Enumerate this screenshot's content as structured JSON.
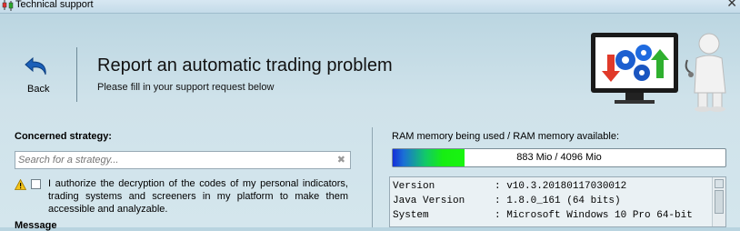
{
  "window": {
    "title": "Technical support"
  },
  "header": {
    "back_label": "Back",
    "title": "Report an automatic trading problem",
    "subtitle": "Please fill in your support request below"
  },
  "form": {
    "strategy_label": "Concerned strategy:",
    "search_placeholder": "Search for a strategy...",
    "consent_text": "I authorize the decryption of the codes of my personal indicators, trading systems and screeners in my platform to make them accessible and analyzable.",
    "consent_checked": false,
    "message_label": "Message"
  },
  "system": {
    "ram_label": "RAM memory being used / RAM memory available:",
    "ram_used_mio": 883,
    "ram_total_mio": 4096,
    "ram_text": "883 Mio / 4096 Mio",
    "info_rows": [
      {
        "key": "Version",
        "value": ": v10.3.20180117030012"
      },
      {
        "key": "Java Version",
        "value": ": 1.8.0_161 (64 bits)"
      },
      {
        "key": "System",
        "value": ": Microsoft Windows 10 Pro 64-bit"
      }
    ]
  },
  "colors": {
    "ram_bar_start": "#1530d8",
    "ram_bar_end": "#19f510",
    "background": "#cfe2ea",
    "back_arrow": "#1b5fb8"
  },
  "icons": {
    "app": "candlestick-chart-icon",
    "close": "close-icon",
    "back": "back-arrow-icon",
    "clear": "clear-icon",
    "warning": "warning-icon",
    "illustration": "support-monitor-illustration"
  }
}
